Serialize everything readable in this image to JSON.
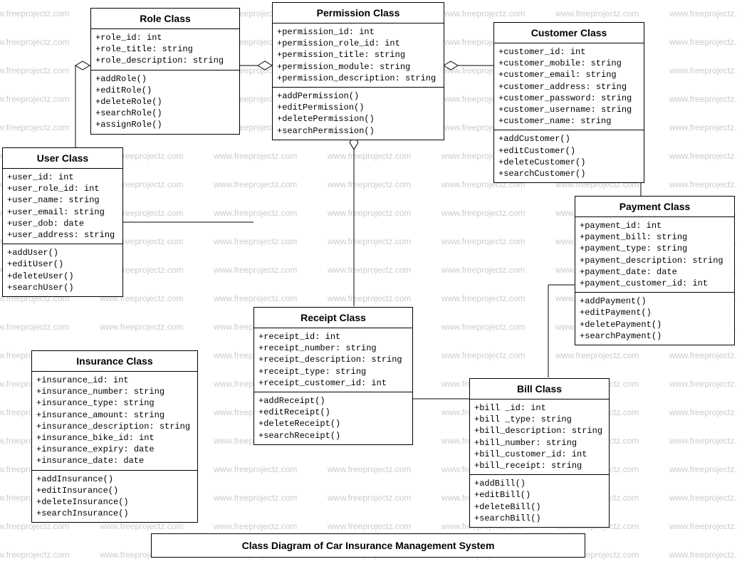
{
  "title": "Class Diagram of Car Insurance Management System",
  "watermark_text": "www.freeprojectz.com",
  "classes": {
    "role": {
      "name": "Role Class",
      "attributes": [
        "+role_id: int",
        "+role_title: string",
        "+role_description: string"
      ],
      "methods": [
        "+addRole()",
        "+editRole()",
        "+deleteRole()",
        "+searchRole()",
        "+assignRole()"
      ]
    },
    "permission": {
      "name": "Permission Class",
      "attributes": [
        "+permission_id: int",
        "+permission_role_id: int",
        "+permission_title: string",
        "+permission_module: string",
        "+permission_description: string"
      ],
      "methods": [
        "+addPermission()",
        "+editPermission()",
        "+deletePermission()",
        "+searchPermission()"
      ]
    },
    "customer": {
      "name": "Customer Class",
      "attributes": [
        "+customer_id: int",
        "+customer_mobile: string",
        "+customer_email: string",
        "+customer_address: string",
        "+customer_password: string",
        "+customer_username: string",
        "+customer_name: string"
      ],
      "methods": [
        "+addCustomer()",
        "+editCustomer()",
        "+deleteCustomer()",
        "+searchCustomer()"
      ]
    },
    "user": {
      "name": "User Class",
      "attributes": [
        "+user_id: int",
        "+user_role_id: int",
        "+user_name: string",
        "+user_email: string",
        "+user_dob: date",
        "+user_address: string"
      ],
      "methods": [
        "+addUser()",
        "+editUser()",
        "+deleteUser()",
        "+searchUser()"
      ]
    },
    "payment": {
      "name": "Payment Class",
      "attributes": [
        "+payment_id: int",
        "+payment_bill: string",
        "+payment_type: string",
        "+payment_description: string",
        "+payment_date: date",
        "+payment_customer_id: int"
      ],
      "methods": [
        "+addPayment()",
        "+editPayment()",
        "+deletePayment()",
        "+searchPayment()"
      ]
    },
    "receipt": {
      "name": "Receipt Class",
      "attributes": [
        "+receipt_id: int",
        "+receipt_number: string",
        "+receipt_description: string",
        "+receipt_type: string",
        "+receipt_customer_id: int"
      ],
      "methods": [
        "+addReceipt()",
        "+editReceipt()",
        "+deleteReceipt()",
        "+searchReceipt()"
      ]
    },
    "insurance": {
      "name": "Insurance Class",
      "attributes": [
        "+insurance_id: int",
        "+insurance_number: string",
        "+insurance_type: string",
        "+insurance_amount: string",
        "+insurance_description: string",
        "+insurance_bike_id: int",
        "+insurance_expiry: date",
        "+insurance_date: date"
      ],
      "methods": [
        "+addInsurance()",
        "+editInsurance()",
        "+deleteInsurance()",
        "+searchInsurance()"
      ]
    },
    "bill": {
      "name": "Bill Class",
      "attributes": [
        "+bill _id: int",
        "+bill _type: string",
        "+bill_description: string",
        "+bill_number: string",
        "+bill_customer_id: int",
        "+bill_receipt: string"
      ],
      "methods": [
        "+addBill()",
        "+editBill()",
        "+deleteBill()",
        "+searchBill()"
      ]
    }
  }
}
